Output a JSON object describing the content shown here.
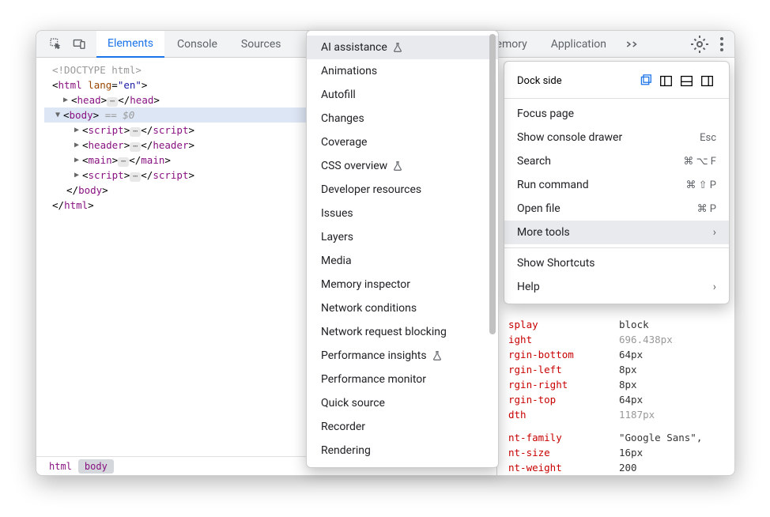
{
  "tabs": {
    "elements": "Elements",
    "console": "Console",
    "sources": "Sources",
    "memory_partial": "emory",
    "application": "Application"
  },
  "dom": {
    "doctype": "<!DOCTYPE html>",
    "html_open": "html",
    "html_lang_attr": "lang",
    "html_lang_val": "\"en\"",
    "head": "head",
    "body": "body",
    "body_equals": "== $0",
    "script": "script",
    "header": "header",
    "main": "main",
    "html_close": "html"
  },
  "breadcrumb": {
    "html": "html",
    "body": "body"
  },
  "main_menu": {
    "dock_side": "Dock side",
    "focus_page": "Focus page",
    "show_console": "Show console drawer",
    "show_console_key": "Esc",
    "search": "Search",
    "search_key": "⌘ ⌥ F",
    "run_command": "Run command",
    "run_command_key": "⌘ ⇧ P",
    "open_file": "Open file",
    "open_file_key": "⌘ P",
    "more_tools": "More tools",
    "show_shortcuts": "Show Shortcuts",
    "help": "Help"
  },
  "submenu": {
    "ai_assistance": "AI assistance",
    "animations": "Animations",
    "autofill": "Autofill",
    "changes": "Changes",
    "coverage": "Coverage",
    "css_overview": "CSS overview",
    "dev_resources": "Developer resources",
    "issues": "Issues",
    "layers": "Layers",
    "media": "Media",
    "memory_inspector": "Memory inspector",
    "network_conditions": "Network conditions",
    "network_blocking": "Network request blocking",
    "performance_insights": "Performance insights",
    "performance_monitor": "Performance monitor",
    "quick_source": "Quick source",
    "recorder": "Recorder",
    "rendering": "Rendering"
  },
  "styles": {
    "display": {
      "prop": "splay",
      "val": "block"
    },
    "height": {
      "prop": "ight",
      "val": "696.438px"
    },
    "margin_bottom": {
      "prop": "rgin-bottom",
      "val": "64px"
    },
    "margin_left": {
      "prop": "rgin-left",
      "val": "8px"
    },
    "margin_right": {
      "prop": "rgin-right",
      "val": "8px"
    },
    "margin_top": {
      "prop": "rgin-top",
      "val": "64px"
    },
    "width": {
      "prop": "dth",
      "val": "1187px"
    },
    "font_family": {
      "prop": "nt-family",
      "val": "\"Google Sans\","
    },
    "font_size": {
      "prop": "nt-size",
      "val": "16px"
    },
    "font_weight": {
      "prop": "nt-weight",
      "val": "200"
    }
  }
}
